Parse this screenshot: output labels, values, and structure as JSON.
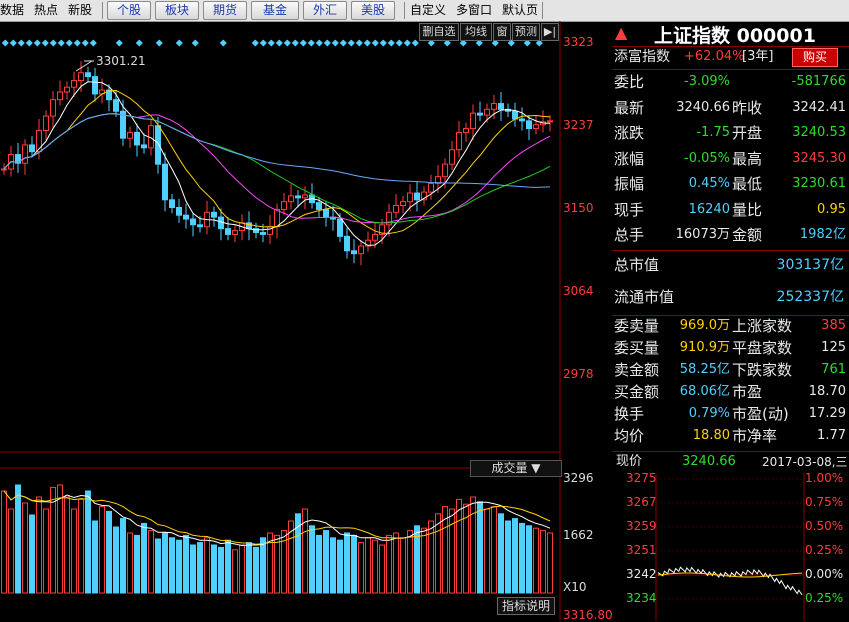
{
  "toolbar": {
    "left_partial": [
      "数据",
      "热点",
      "新股"
    ],
    "market_buttons": [
      "个股",
      "板块",
      "期货",
      "基金",
      "外汇",
      "美股"
    ],
    "right_links": [
      "自定义",
      "多窗口",
      "默认页"
    ]
  },
  "chart_buttons": [
    "删自选",
    "均线",
    "窗",
    "预测"
  ],
  "price_chart": {
    "peak_label": "3301.21",
    "y_ticks": [
      "3323",
      "3237",
      "3150",
      "3064",
      "2978"
    ]
  },
  "volume_chart": {
    "selector_label": "成交量",
    "y_ticks": [
      "3296",
      "1662"
    ],
    "multiplier": "X10",
    "indicator_button": "指标说明",
    "bottom_partial": "3316.80"
  },
  "colors": {
    "up": "#ff3c3c",
    "down": "#4fd0ff",
    "ma5": "#ffffff",
    "ma10": "#ffd200",
    "ma20": "#ff44ff",
    "ma30": "#22cc22",
    "ma60": "#6aa8ff"
  },
  "header": {
    "icon": "triangle-up-icon",
    "title": "上证指数 000001"
  },
  "wealth": {
    "label": "添富指数",
    "value": "+62.04%",
    "period": "[3年]",
    "buy_label": "购买"
  },
  "quote_rows": [
    {
      "l1": "委比",
      "v1": "-3.09%",
      "c1": "grn",
      "l2": "",
      "v2": "-581766",
      "c2": "grn"
    },
    {
      "l1": "最新",
      "v1": "3240.66",
      "c1": "wht",
      "l2": "昨收",
      "v2": "3242.41",
      "c2": "wht"
    },
    {
      "l1": "涨跌",
      "v1": "-1.75",
      "c1": "grn",
      "l2": "开盘",
      "v2": "3240.53",
      "c2": "grn"
    },
    {
      "l1": "涨幅",
      "v1": "-0.05%",
      "c1": "grn",
      "l2": "最高",
      "v2": "3245.30",
      "c2": "red"
    },
    {
      "l1": "振幅",
      "v1": "0.45%",
      "c1": "cyan",
      "l2": "最低",
      "v2": "3230.61",
      "c2": "grn"
    },
    {
      "l1": "现手",
      "v1": "16240",
      "c1": "cyan",
      "l2": "量比",
      "v2": "0.95",
      "c2": "yel"
    },
    {
      "l1": "总手",
      "v1": "16073万",
      "c1": "wht",
      "l2": "金额",
      "v2": "1982亿",
      "c2": "cyan"
    }
  ],
  "market_value": [
    {
      "label": "总市值",
      "value": "303137亿"
    },
    {
      "label": "流通市值",
      "value": "252337亿"
    }
  ],
  "order_rows": [
    {
      "l1": "委卖量",
      "v1": "969.0万",
      "c1": "yel",
      "l2": "上涨家数",
      "v2": "385",
      "c2": "red"
    },
    {
      "l1": "委买量",
      "v1": "910.9万",
      "c1": "yel",
      "l2": "平盘家数",
      "v2": "125",
      "c2": "wht"
    },
    {
      "l1": "卖金额",
      "v1": "58.25亿",
      "c1": "cyan",
      "l2": "下跌家数",
      "v2": "761",
      "c2": "grn"
    },
    {
      "l1": "买金额",
      "v1": "68.06亿",
      "c1": "cyan",
      "l2": "市盈",
      "v2": "18.70",
      "c2": "wht"
    },
    {
      "l1": "换手",
      "v1": "0.79%",
      "c1": "cyan",
      "l2": "市盈(动)",
      "v2": "17.29",
      "c2": "wht"
    },
    {
      "l1": "均价",
      "v1": "18.80",
      "c1": "yel",
      "l2": "市净率",
      "v2": "1.77",
      "c2": "wht"
    }
  ],
  "intraday": {
    "label": "现价",
    "price": "3240.66",
    "date": "2017-03-08,三",
    "left_ticks": [
      "3275",
      "3267",
      "3259",
      "3251",
      "3242",
      "3234"
    ],
    "right_ticks": [
      "1.00%",
      "0.75%",
      "0.50%",
      "0.25%",
      "0.00%",
      "0.25%"
    ]
  }
}
